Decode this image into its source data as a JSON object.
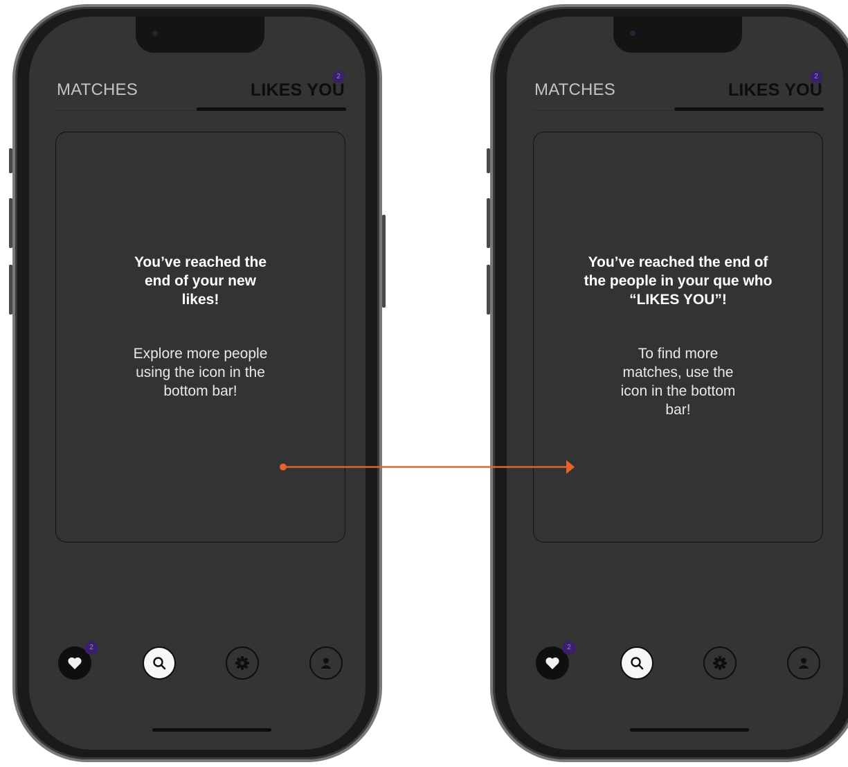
{
  "colors": {
    "screen_bg": "#343434",
    "active_tab": "#0d0d0d",
    "inactive_tab": "#c4c4c4",
    "badge": "#3a1f6b",
    "arrow": "#e8632b"
  },
  "phones": [
    {
      "tabs": {
        "matches": "MATCHES",
        "likes_you": "LIKES YOU",
        "likes_badge": "2"
      },
      "message": {
        "title": "You’ve reached the end of your new likes!",
        "body": "Explore more people using the icon in the bottom bar!"
      },
      "nav": {
        "heart_badge": "2",
        "icons": [
          "heart-icon",
          "search-icon",
          "gear-icon",
          "profile-icon"
        ]
      }
    },
    {
      "tabs": {
        "matches": "MATCHES",
        "likes_you": "LIKES YOU",
        "likes_badge": "2"
      },
      "message": {
        "title": "You’ve reached the end of the people in your que who “LIKES YOU”!",
        "body": "To find more matches, use the icon in the bottom bar!"
      },
      "nav": {
        "heart_badge": "2",
        "icons": [
          "heart-icon",
          "search-icon",
          "gear-icon",
          "profile-icon"
        ]
      }
    }
  ]
}
